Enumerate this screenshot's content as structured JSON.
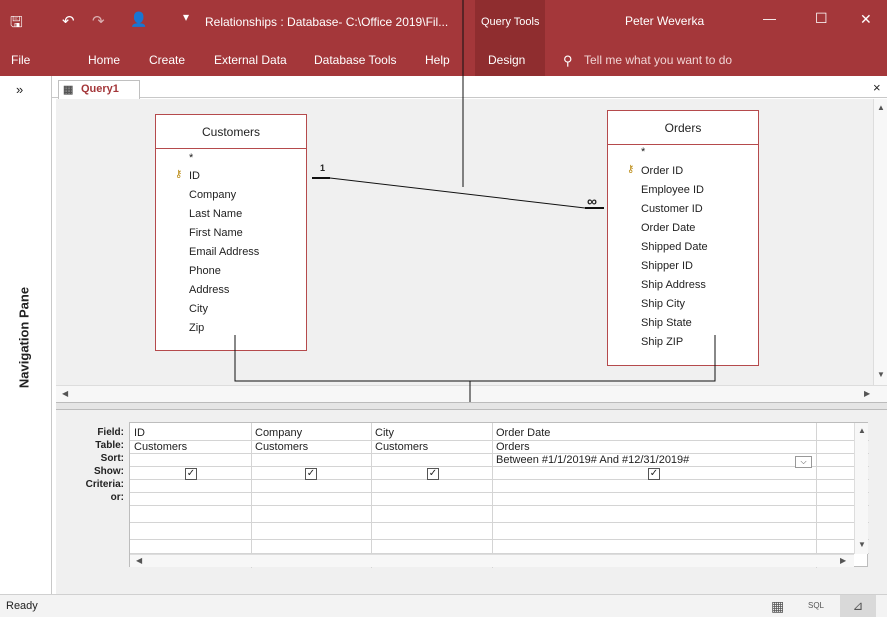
{
  "titlebar": {
    "window_title": "Relationships : Database- C:\\Office 2019\\Fil...",
    "context": "Query Tools",
    "user": "Peter Weverka",
    "minimize": "—",
    "restore": "☐",
    "close": "✕"
  },
  "quickaccess": {
    "save": "🖫",
    "undo": "↶",
    "redo": "↷",
    "user": "👤"
  },
  "ribbon": {
    "tabs": [
      "File",
      "Home",
      "Create",
      "External Data",
      "Database Tools",
      "Help",
      "Design"
    ],
    "tell_me": "Tell me what you want to do"
  },
  "nav": {
    "expand": "»",
    "label": "Navigation Pane"
  },
  "doc": {
    "tab": "Query1",
    "close": "×"
  },
  "customers": {
    "title": "Customers",
    "fields": [
      "*",
      "ID",
      "Company",
      "Last Name",
      "First Name",
      "Email Address",
      "Phone",
      "Address",
      "City",
      "Zip"
    ]
  },
  "orders": {
    "title": "Orders",
    "fields": [
      "*",
      "Order ID",
      "Employee ID",
      "Customer ID",
      "Order Date",
      "Shipped Date",
      "Shipper ID",
      "Ship Address",
      "Ship City",
      "Ship State",
      "Ship ZIP"
    ]
  },
  "relationship": {
    "one": "1",
    "many": "∞"
  },
  "grid": {
    "row_labels": [
      "Field:",
      "Table:",
      "Sort:",
      "Show:",
      "Criteria:",
      "or:"
    ],
    "columns": [
      {
        "field": "ID",
        "table": "Customers",
        "criteria": "",
        "show": true
      },
      {
        "field": "Company",
        "table": "Customers",
        "criteria": "",
        "show": true
      },
      {
        "field": "City",
        "table": "Customers",
        "criteria": "",
        "show": true
      },
      {
        "field": "Order Date",
        "table": "Orders",
        "criteria": "Between #1/1/2019# And #12/31/2019#",
        "show": true
      }
    ]
  },
  "status": {
    "text": "Ready",
    "sql": "SQL"
  }
}
